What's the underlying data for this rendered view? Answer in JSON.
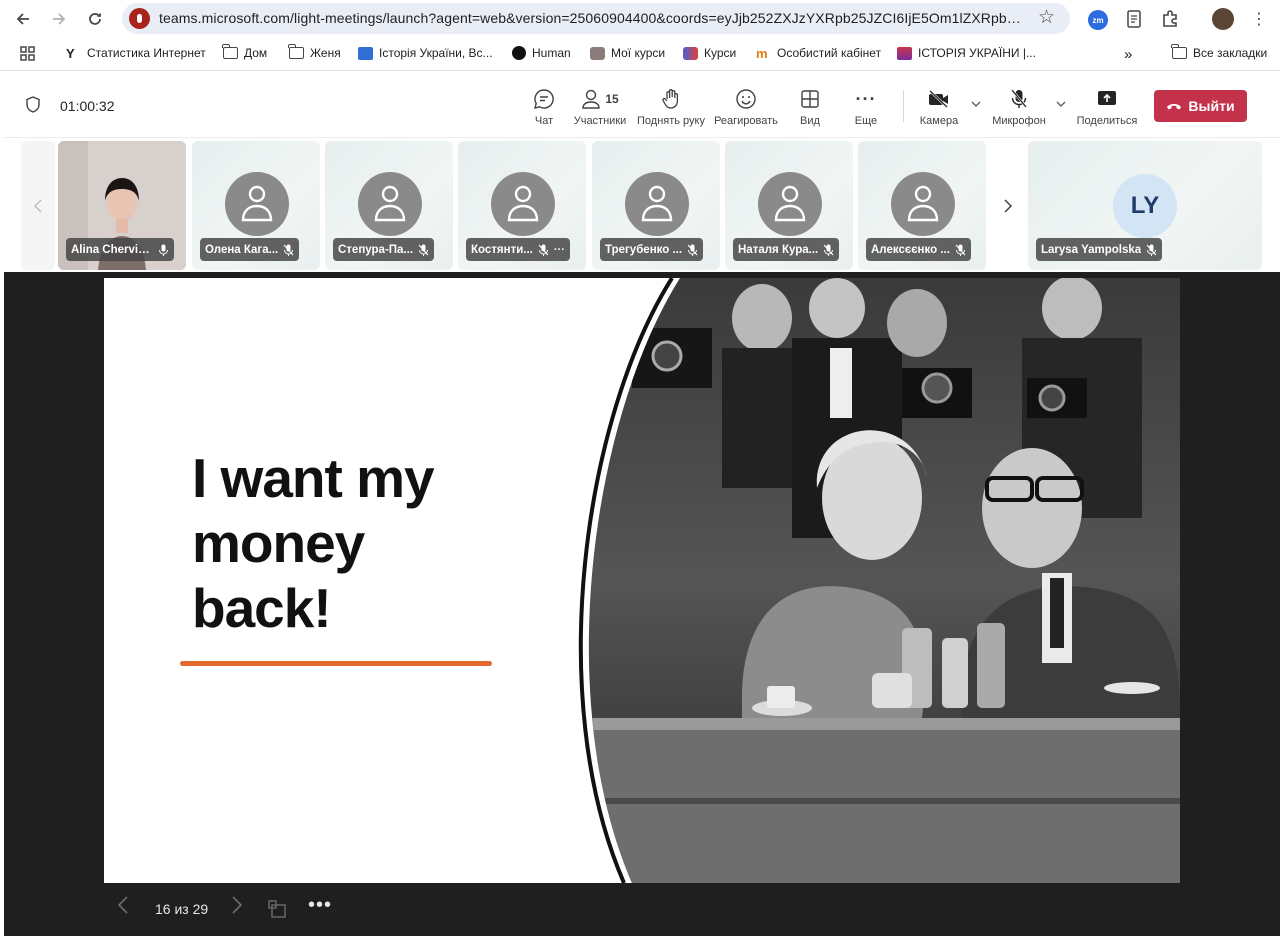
{
  "browser": {
    "url": "teams.microsoft.com/light-meetings/launch?agent=web&version=25060904400&coords=eyJjb252ZXJzYXRpb25JZCI6IjE5Om1lZXRpbmdfT...",
    "bookmarks": [
      {
        "label": "Статистика Интернет",
        "icon": "wix-icon"
      },
      {
        "label": "Дом",
        "icon": "folder-icon"
      },
      {
        "label": "Женя",
        "icon": "folder-icon"
      },
      {
        "label": "Історія України, Вс...",
        "icon": "classroom-icon"
      },
      {
        "label": "Human",
        "icon": "human-icon"
      },
      {
        "label": "Мої курси",
        "icon": "course-icon"
      },
      {
        "label": "Курси",
        "icon": "course-icon"
      },
      {
        "label": "Особистий кабінет",
        "icon": "m-icon"
      },
      {
        "label": "ІСТОРІЯ УКРАЇНИ |...",
        "icon": "book-icon"
      }
    ],
    "all_bookmarks": "Все закладки"
  },
  "meeting": {
    "timer": "01:00:32",
    "participants_count": "15",
    "tools": {
      "chat": "Чат",
      "participants": "Участники",
      "raise_hand": "Поднять руку",
      "react": "Реагировать",
      "view": "Вид",
      "more": "Еще",
      "camera": "Камера",
      "mic": "Микрофон",
      "share": "Поделиться"
    },
    "leave": "Выйти",
    "accent": "#c4314b"
  },
  "participants": [
    {
      "name": "Alina Chervia...",
      "type": "video"
    },
    {
      "name": "Олена Кага...",
      "type": "avatar"
    },
    {
      "name": "Степура-Па...",
      "type": "avatar"
    },
    {
      "name": "Костянти...",
      "type": "avatar"
    },
    {
      "name": "Трегубенко ...",
      "type": "avatar"
    },
    {
      "name": "Наталя Кура...",
      "type": "avatar"
    },
    {
      "name": "Алексєєнко ...",
      "type": "avatar"
    },
    {
      "name": "Larysa Yampolska",
      "type": "initials",
      "initials": "LY"
    }
  ],
  "slide": {
    "title": "I want my money back!",
    "accent": "#e06a2c",
    "page": "16 из 29"
  }
}
